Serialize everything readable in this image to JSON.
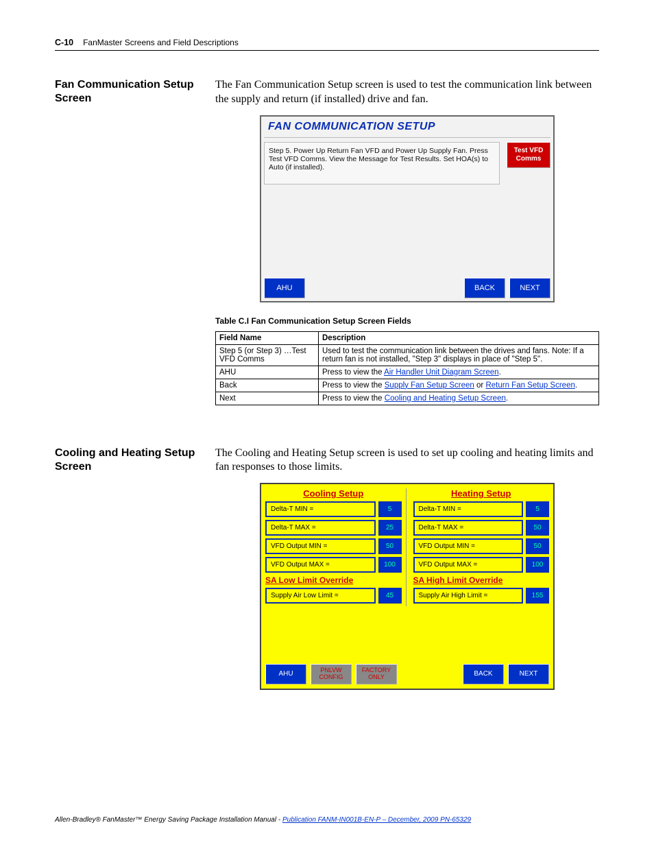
{
  "header": {
    "page_num": "C-10",
    "breadcrumb": "FanMaster Screens and Field Descriptions"
  },
  "section1": {
    "title": "Fan Communication Setup Screen",
    "body": "The Fan Communication Setup screen is used to test the communication link between the supply and return (if installed) drive and fan.",
    "screen": {
      "title": "FAN COMMUNICATION SETUP",
      "step_text": "Step 5.   Power Up Return Fan VFD and Power Up Supply Fan.  Press Test VFD Comms.  View the Message for Test Results.  Set HOA(s) to Auto (if installed).",
      "test_btn": "Test VFD Comms",
      "ahu_btn": "AHU",
      "back_btn": "BACK",
      "next_btn": "NEXT"
    },
    "table_caption": "Table C.I     Fan Communication Setup Screen Fields",
    "table": {
      "head": {
        "c1": "Field Name",
        "c2": "Description"
      },
      "rows": [
        {
          "c1": "Step 5 (or Step 3) …Test VFD Comms",
          "c2a": "Used to test the communication link between the drives and fans. Note: If a return fan is not installed, \"Step 3\" displays in place of \"Step 5\"."
        },
        {
          "c1": "AHU",
          "c2a": "Press to view the ",
          "c2link": "Air Handler Unit Diagram Screen",
          "c2b": "."
        },
        {
          "c1": "Back",
          "c2a": "Press to view the ",
          "c2link": "Supply Fan Setup Screen",
          "c2mid": " or ",
          "c2link2": "Return Fan Setup Screen",
          "c2b": "."
        },
        {
          "c1": "Next",
          "c2a": "Press to view the ",
          "c2link": "Cooling and Heating Setup Screen",
          "c2b": "."
        }
      ]
    }
  },
  "section2": {
    "title": "Cooling and Heating Setup Screen",
    "body": "The Cooling and Heating Setup screen is used to set up cooling and heating limits and fan responses to those limits.",
    "screen": {
      "cooling": {
        "title": "Cooling Setup",
        "rows": [
          {
            "label": "Delta-T MIN =",
            "val": "5"
          },
          {
            "label": "Delta-T MAX =",
            "val": "25"
          },
          {
            "label": "VFD Output MIN =",
            "val": "50"
          },
          {
            "label": "VFD Output MAX =",
            "val": "100"
          }
        ],
        "sub": "SA Low Limit Override",
        "limit": {
          "label": "Supply Air Low Limit =",
          "val": "45"
        }
      },
      "heating": {
        "title": "Heating Setup",
        "rows": [
          {
            "label": "Delta-T MIN =",
            "val": "5"
          },
          {
            "label": "Delta-T MAX =",
            "val": "50"
          },
          {
            "label": "VFD Output MIN =",
            "val": "50"
          },
          {
            "label": "VFD Output MAX =",
            "val": "100"
          }
        ],
        "sub": "SA High Limit Override",
        "limit": {
          "label": "Supply Air High Limit =",
          "val": "155"
        }
      },
      "footer": {
        "ahu": "AHU",
        "pnlvw": "PNLVW CONFIG",
        "factory": "FACTORY ONLY",
        "back": "BACK",
        "next": "NEXT"
      }
    }
  },
  "footer": {
    "text_a": "Allen-Bradley® FanMaster™ Energy Saving Package Installation Manual - ",
    "link": "Publication FANM-IN001B-EN-P – December, 2009 PN-65329"
  }
}
